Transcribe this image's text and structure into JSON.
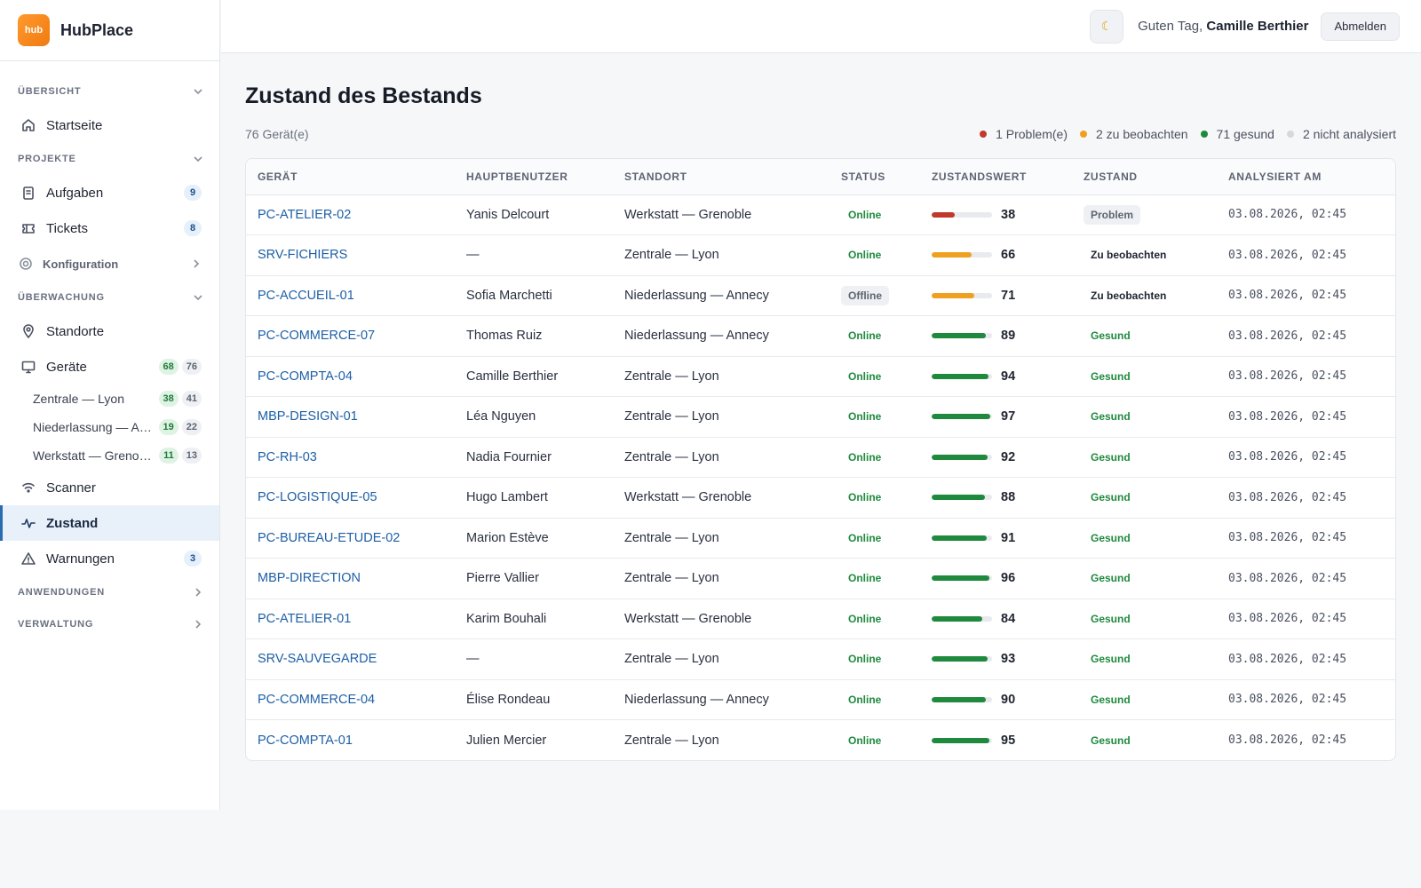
{
  "brand": {
    "logo_text": "hub",
    "name": "HubPlace"
  },
  "colors": {
    "accent": "#2b6cb0",
    "problem": "#c0392b",
    "watch": "#f0a020",
    "healthy": "#1f8a3e",
    "unanalyzed": "#d5d8dd"
  },
  "sidebar": {
    "sections": {
      "overview": "ÜBERSICHT",
      "projects": "PROJEKTE",
      "monitoring": "ÜBERWACHUNG",
      "applications": "ANWENDUNGEN",
      "administration": "VERWALTUNG"
    },
    "items": {
      "home": {
        "label": "Startseite",
        "icon": "home-icon"
      },
      "tasks": {
        "label": "Aufgaben",
        "icon": "clipboard-icon",
        "badge": "9"
      },
      "tickets": {
        "label": "Tickets",
        "icon": "ticket-icon",
        "badge": "8"
      },
      "config": {
        "label": "Konfiguration",
        "icon": "gear-icon"
      },
      "locations": {
        "label": "Standorte",
        "icon": "pin-icon"
      },
      "devices": {
        "label": "Geräte",
        "icon": "monitor-icon",
        "badge_ok": "68",
        "badge_total": "76"
      },
      "loc_lyon": {
        "label": "Zentrale — Lyon",
        "badge_ok": "38",
        "badge_total": "41"
      },
      "loc_annecy": {
        "label": "Niederlassung — Annecy",
        "badge_ok": "19",
        "badge_total": "22"
      },
      "loc_grenoble": {
        "label": "Werkstatt — Grenoble",
        "badge_ok": "11",
        "badge_total": "13"
      },
      "scanner": {
        "label": "Scanner",
        "icon": "wifi-icon"
      },
      "health": {
        "label": "Zustand",
        "icon": "pulse-icon"
      },
      "warnings": {
        "label": "Warnungen",
        "icon": "warning-icon",
        "badge": "3"
      }
    }
  },
  "topbar": {
    "theme_icon": "moon-icon",
    "greeting": "Guten Tag,",
    "user": "Camille Berthier",
    "logout": "Abmelden"
  },
  "main": {
    "title": "Zustand des Bestands",
    "count": "76 Gerät(e)",
    "legend": [
      {
        "label": "1 Problem(e)",
        "color": "#c0392b"
      },
      {
        "label": "2 zu beobachten",
        "color": "#f0a020"
      },
      {
        "label": "71 gesund",
        "color": "#1f8a3e"
      },
      {
        "label": "2 nicht analysiert",
        "color": "#d5d8dd"
      }
    ],
    "columns": [
      "GERÄT",
      "HAUPTBENUTZER",
      "STANDORT",
      "STATUS",
      "ZUSTANDSWERT",
      "ZUSTAND",
      "ANALYSIERT AM"
    ],
    "rows": [
      {
        "device": "PC-ATELIER-02",
        "user": "Yanis Delcourt",
        "location": "Werkstatt — Grenoble",
        "status": "Online",
        "score": 38,
        "condition": "Problem",
        "analyzed": "03.08.2026, 02:45"
      },
      {
        "device": "SRV-FICHIERS",
        "user": "—",
        "location": "Zentrale — Lyon",
        "status": "Online",
        "score": 66,
        "condition": "Zu beobachten",
        "analyzed": "03.08.2026, 02:45"
      },
      {
        "device": "PC-ACCUEIL-01",
        "user": "Sofia Marchetti",
        "location": "Niederlassung — Annecy",
        "status": "Offline",
        "score": 71,
        "condition": "Zu beobachten",
        "analyzed": "03.08.2026, 02:45"
      },
      {
        "device": "PC-COMMERCE-07",
        "user": "Thomas Ruiz",
        "location": "Niederlassung — Annecy",
        "status": "Online",
        "score": 89,
        "condition": "Gesund",
        "analyzed": "03.08.2026, 02:45"
      },
      {
        "device": "PC-COMPTA-04",
        "user": "Camille Berthier",
        "location": "Zentrale — Lyon",
        "status": "Online",
        "score": 94,
        "condition": "Gesund",
        "analyzed": "03.08.2026, 02:45"
      },
      {
        "device": "MBP-DESIGN-01",
        "user": "Léa Nguyen",
        "location": "Zentrale — Lyon",
        "status": "Online",
        "score": 97,
        "condition": "Gesund",
        "analyzed": "03.08.2026, 02:45"
      },
      {
        "device": "PC-RH-03",
        "user": "Nadia Fournier",
        "location": "Zentrale — Lyon",
        "status": "Online",
        "score": 92,
        "condition": "Gesund",
        "analyzed": "03.08.2026, 02:45"
      },
      {
        "device": "PC-LOGISTIQUE-05",
        "user": "Hugo Lambert",
        "location": "Werkstatt — Grenoble",
        "status": "Online",
        "score": 88,
        "condition": "Gesund",
        "analyzed": "03.08.2026, 02:45"
      },
      {
        "device": "PC-BUREAU-ETUDE-02",
        "user": "Marion Estève",
        "location": "Zentrale — Lyon",
        "status": "Online",
        "score": 91,
        "condition": "Gesund",
        "analyzed": "03.08.2026, 02:45"
      },
      {
        "device": "MBP-DIRECTION",
        "user": "Pierre Vallier",
        "location": "Zentrale — Lyon",
        "status": "Online",
        "score": 96,
        "condition": "Gesund",
        "analyzed": "03.08.2026, 02:45"
      },
      {
        "device": "PC-ATELIER-01",
        "user": "Karim Bouhali",
        "location": "Werkstatt — Grenoble",
        "status": "Online",
        "score": 84,
        "condition": "Gesund",
        "analyzed": "03.08.2026, 02:45"
      },
      {
        "device": "SRV-SAUVEGARDE",
        "user": "—",
        "location": "Zentrale — Lyon",
        "status": "Online",
        "score": 93,
        "condition": "Gesund",
        "analyzed": "03.08.2026, 02:45"
      },
      {
        "device": "PC-COMMERCE-04",
        "user": "Élise Rondeau",
        "location": "Niederlassung — Annecy",
        "status": "Online",
        "score": 90,
        "condition": "Gesund",
        "analyzed": "03.08.2026, 02:45"
      },
      {
        "device": "PC-COMPTA-01",
        "user": "Julien Mercier",
        "location": "Zentrale — Lyon",
        "status": "Online",
        "score": 95,
        "condition": "Gesund",
        "analyzed": "03.08.2026, 02:45"
      }
    ]
  }
}
